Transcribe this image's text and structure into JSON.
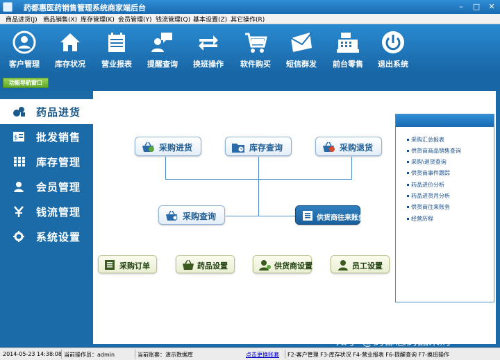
{
  "window": {
    "title": "药都惠医药销售管理系统商家端后台",
    "min": "–",
    "max": "□",
    "close": "✕"
  },
  "menu": [
    "商品进货(J)",
    "商品销售(X)",
    "库存管理(K)",
    "会员管理(Y)",
    "钱流管理(Q)",
    "基本设置(Z)",
    "其它操作(R)"
  ],
  "toolbar": [
    {
      "label": "客户管理",
      "icon": "customer-icon"
    },
    {
      "label": "库存状况",
      "icon": "house-icon"
    },
    {
      "label": "营业报表",
      "icon": "calendar-report-icon"
    },
    {
      "label": "提醒查询",
      "icon": "chat-person-icon"
    },
    {
      "label": "换班操作",
      "icon": "swap-arrows-icon"
    },
    {
      "label": "软件购买",
      "icon": "shopping-cart-icon"
    },
    {
      "label": "短信群发",
      "icon": "envelope-icon"
    },
    {
      "label": "前台零售",
      "icon": "cash-register-icon"
    },
    {
      "label": "退出系统",
      "icon": "power-icon"
    }
  ],
  "nav_window_label": "功能导航窗口",
  "sidebar": [
    {
      "label": "药品进货",
      "icon": "pills-icon",
      "active": true
    },
    {
      "label": "批发销售",
      "icon": "invoice-icon",
      "active": false
    },
    {
      "label": "库存管理",
      "icon": "grid-icon",
      "active": false
    },
    {
      "label": "会员管理",
      "icon": "user-icon",
      "active": false
    },
    {
      "label": "钱流管理",
      "icon": "yen-icon",
      "active": false
    },
    {
      "label": "系统设置",
      "icon": "gear-icon",
      "active": false
    }
  ],
  "flow": {
    "purchase_in": "采购进货",
    "stock_query": "库存查询",
    "purchase_return": "采购退货",
    "purchase_query": "采购查询",
    "supplier_account": "供货商往来账务"
  },
  "bottom_buttons": {
    "purchase_order": "采购订单",
    "drug_settings": "药品设置",
    "supplier_settings": "供货商设置",
    "staff_settings": "员工设置"
  },
  "reports": [
    "采购汇总报表",
    "供货商商品销售查询",
    "采购\\退货查询",
    "供货商事件跟踪",
    "药品进价分析",
    "药品进货月分析",
    "供货商往来账务",
    "经营历程"
  ],
  "status": {
    "datetime": "2014-05-23 14:38:08",
    "operator": "当前操作员：admin",
    "account": "当前账套：演示数据库",
    "switch_account": "点击更换账套",
    "shortcuts": "F2-客户管理 F3-库存状况 F4-营业报表 F6-提醒查询 F7-换班操作"
  },
  "watermark": "知乎 @药都惠药品采购"
}
